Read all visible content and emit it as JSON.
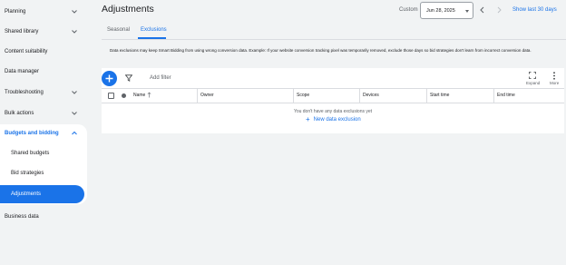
{
  "sidebar": {
    "items": [
      {
        "label": "Planning"
      },
      {
        "label": "Shared library"
      },
      {
        "label": "Content suitability"
      },
      {
        "label": "Data manager"
      },
      {
        "label": "Troubleshooting"
      },
      {
        "label": "Bulk actions"
      },
      {
        "label": "Budgets and bidding"
      },
      {
        "label": "Shared budgets"
      },
      {
        "label": "Bid strategies"
      },
      {
        "label": "Adjustments"
      },
      {
        "label": "Business data"
      }
    ],
    "selected_label": "Adjustments"
  },
  "header": {
    "title": "Adjustments",
    "date_range_label": "Custom",
    "date_value": "Jun 28, 2025",
    "show_last": "Show last 30 days"
  },
  "tabs": [
    {
      "label": "Seasonal"
    },
    {
      "label": "Exclusions"
    }
  ],
  "active_tab": "Exclusions",
  "info_text": "Data exclusions may keep Smart Bidding from using wrong conversion data. Example: If your website conversion tracking pixel was temporarily removed, exclude those days so bid strategies don't learn from incorrect conversion data.",
  "toolbar": {
    "add_filter": "Add filter",
    "expand": "Expand",
    "more": "More"
  },
  "table": {
    "columns": [
      "Name",
      "Owner",
      "Scope",
      "Devices",
      "Start time",
      "End time"
    ],
    "empty_message": "You don't have any data exclusions yet",
    "new_button": "New data exclusion"
  },
  "colors": {
    "accent": "#1a73e8",
    "background": "#f1f3f4"
  }
}
